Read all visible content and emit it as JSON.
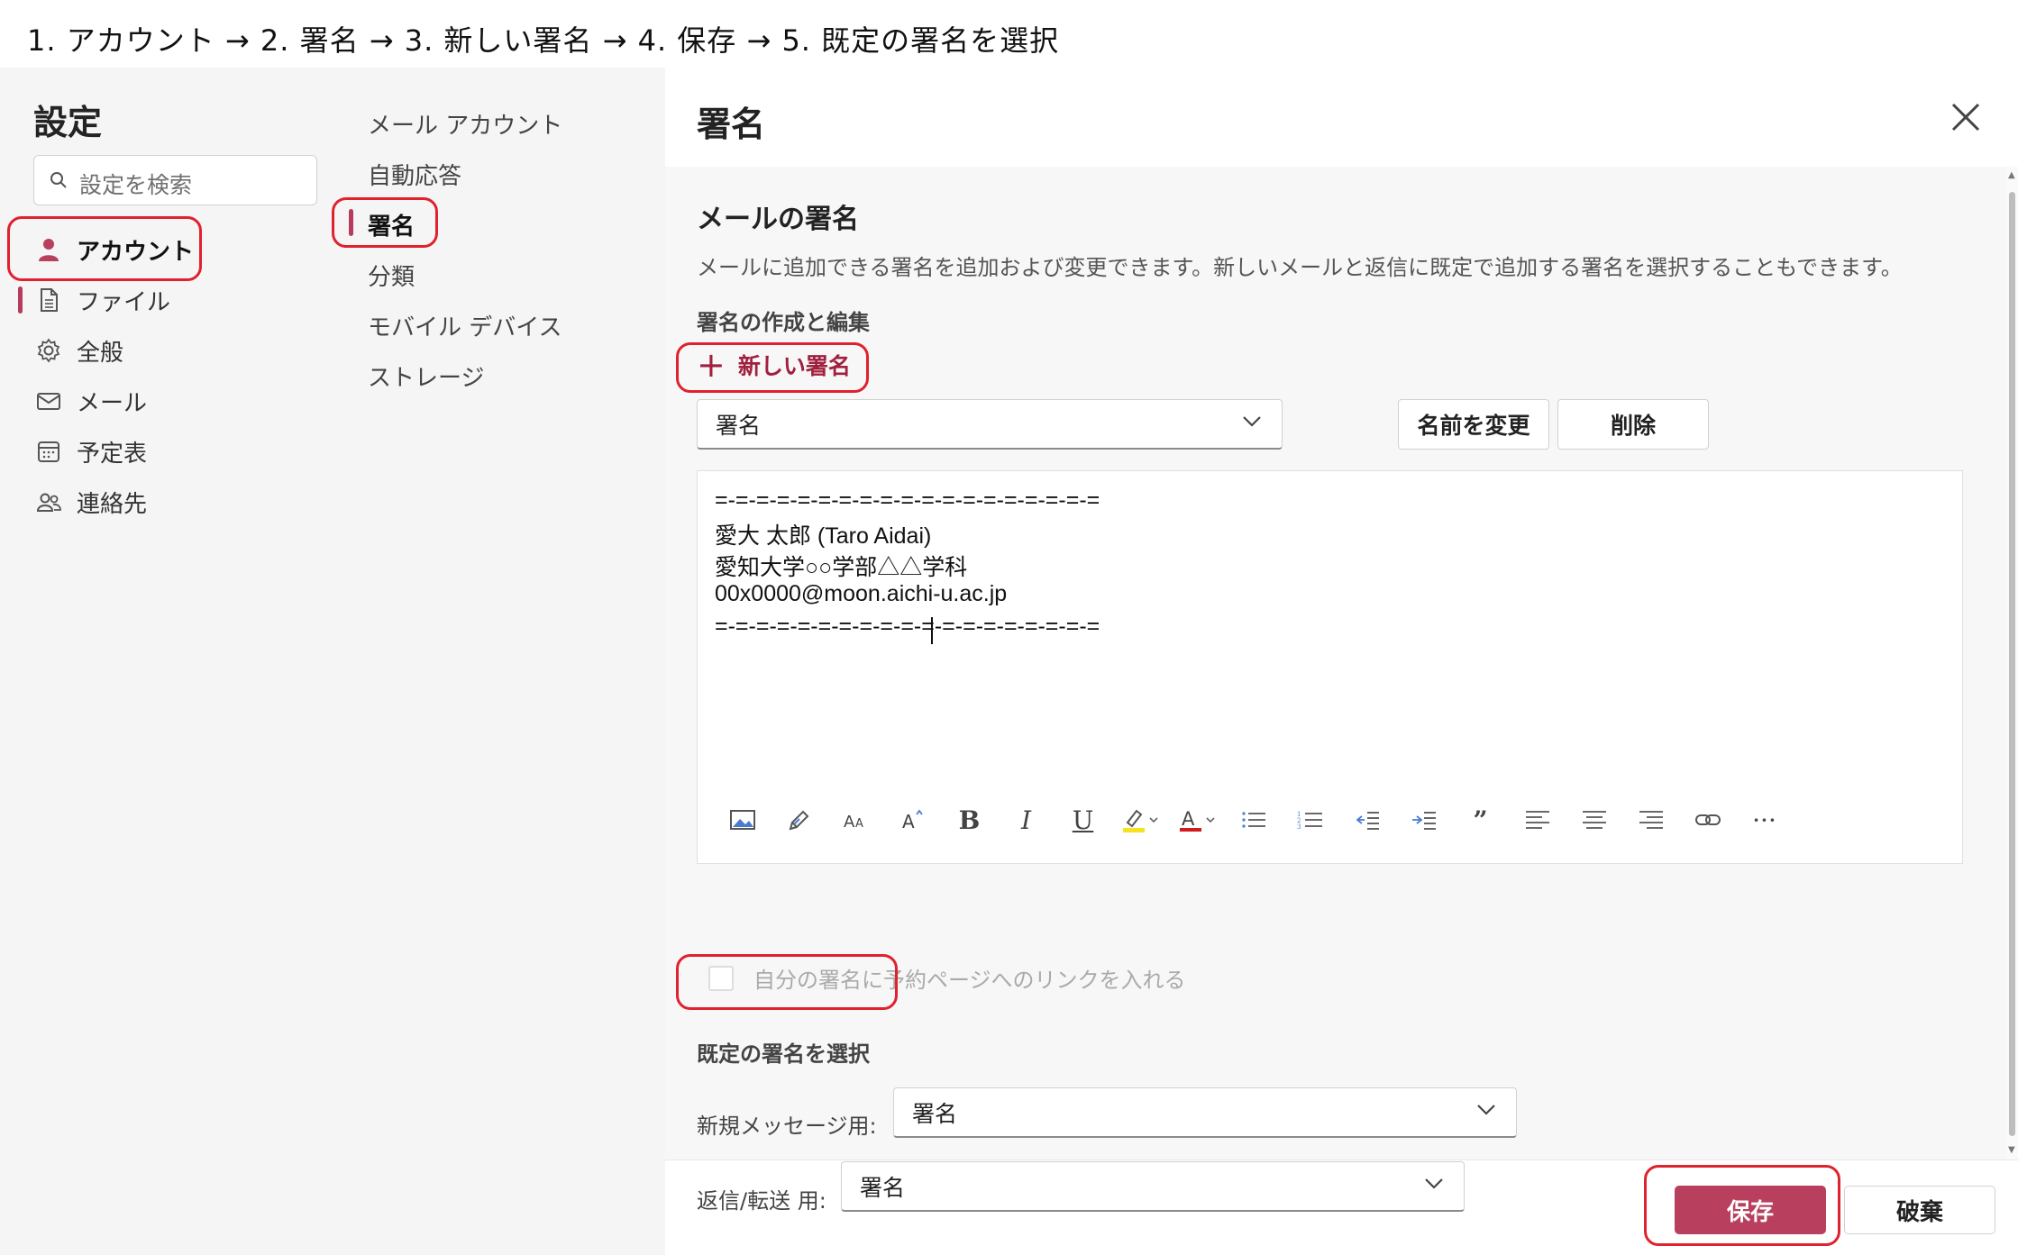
{
  "instructions": "1. アカウント → 2. 署名 → 3. 新しい署名 → 4. 保存 → 5.  既定の署名を選択",
  "settings": {
    "title": "設定",
    "search_placeholder": "設定を検索",
    "nav": [
      {
        "label": "アカウント",
        "icon": "person-icon",
        "active": true
      },
      {
        "label": "ファイル",
        "icon": "file-icon"
      },
      {
        "label": "全般",
        "icon": "gear-icon"
      },
      {
        "label": "メール",
        "icon": "mail-icon"
      },
      {
        "label": "予定表",
        "icon": "calendar-icon"
      },
      {
        "label": "連絡先",
        "icon": "people-icon"
      }
    ],
    "sub_nav": [
      {
        "label": "メール アカウント"
      },
      {
        "label": "自動応答"
      },
      {
        "label": "署名",
        "active": true
      },
      {
        "label": "分類"
      },
      {
        "label": "モバイル デバイス"
      },
      {
        "label": "ストレージ"
      }
    ]
  },
  "panel": {
    "title": "署名",
    "section_title": "メールの署名",
    "description": "メールに追加できる署名を追加および変更できます。新しいメールと返信に既定で追加する署名を選択することもできます。",
    "create_heading": "署名の作成と編集",
    "new_signature": "新しい署名",
    "signature_select": "署名",
    "rename_button": "名前を変更",
    "delete_button": "削除",
    "signature_lines": [
      "=-=-=-=-=-=-=-=-=-=-=-=-=-=-=-=-=-=-=",
      "愛大 太郎 (Taro Aidai)",
      "愛知大学○○学部△△学科",
      "00x0000@moon.aichi-u.ac.jp",
      "=-=-=-=-=-=-=-=-=-=-=-=-=-=-=-=-=-=-="
    ],
    "toolbar_text": {
      "bold": "B",
      "italic": "I",
      "underline": "U",
      "quote": "”",
      "more": "···"
    },
    "booking_link_label": "自分の署名に予約ページへのリンクを入れる",
    "default_heading": "既定の署名を選択",
    "new_message_label": "新規メッセージ用:",
    "new_message_value": "署名",
    "reply_label": "返信/転送 用:",
    "reply_value": "署名",
    "save_button": "保存",
    "discard_button": "破棄"
  },
  "colors": {
    "accent": "#b8405e",
    "highlight": "#e0212e"
  }
}
